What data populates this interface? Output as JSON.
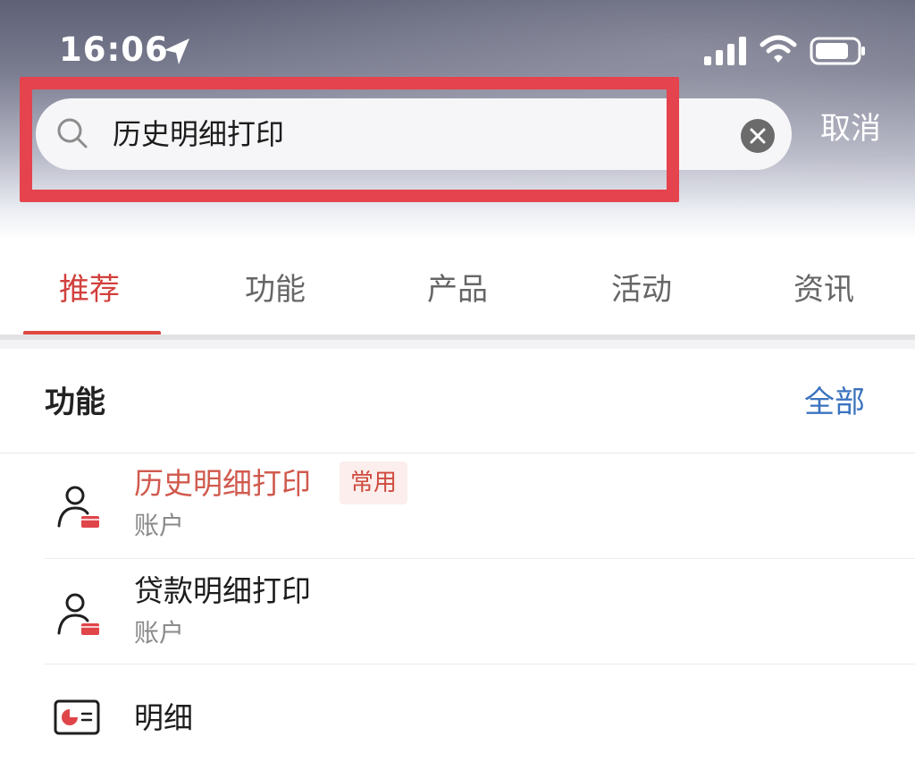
{
  "status_bar": {
    "time": "16:06",
    "icons": [
      "location-arrow-icon",
      "signal-icon",
      "wifi-icon",
      "battery-icon"
    ]
  },
  "search": {
    "query": "历史明细打印",
    "cancel_label": "取消",
    "icons": [
      "search-icon",
      "clear-icon"
    ]
  },
  "tabs": [
    {
      "label": "推荐",
      "active": true
    },
    {
      "label": "功能",
      "active": false
    },
    {
      "label": "产品",
      "active": false
    },
    {
      "label": "活动",
      "active": false
    },
    {
      "label": "资讯",
      "active": false
    }
  ],
  "section": {
    "title": "功能",
    "all_label": "全部"
  },
  "results": [
    {
      "title": "历史明细打印",
      "subtitle": "账户",
      "badge": "常用",
      "icon": "user-card-icon",
      "highlighted": true
    },
    {
      "title": "贷款明细打印",
      "subtitle": "账户",
      "icon": "user-card-icon",
      "highlighted": false
    },
    {
      "title": "明细",
      "icon": "statement-card-icon",
      "highlighted": false
    }
  ],
  "colors": {
    "accent": "#d2403d",
    "highlight_frame": "#e5434d",
    "link": "#3b73bf",
    "muted": "#8a8a8a"
  }
}
